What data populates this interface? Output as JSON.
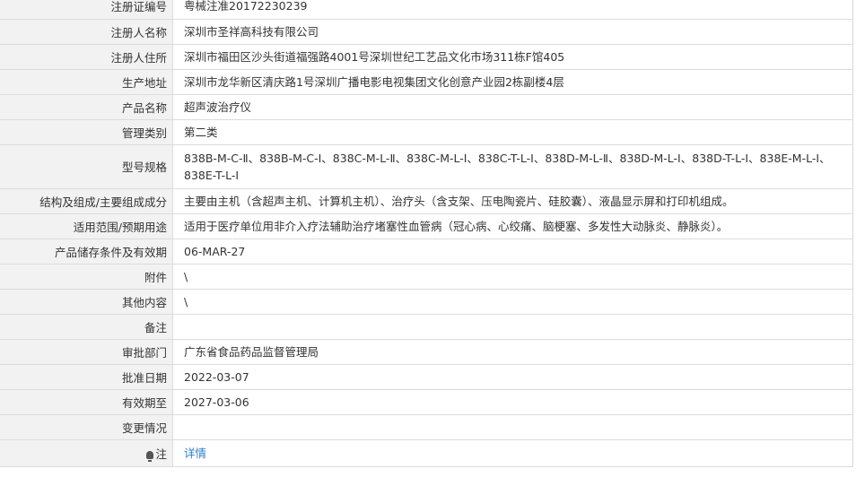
{
  "rows": [
    {
      "label": "注册证编号",
      "value": "粤械注准20172230239"
    },
    {
      "label": "注册人名称",
      "value": "深圳市圣祥高科技有限公司"
    },
    {
      "label": "注册人住所",
      "value": "深圳市福田区沙头街道福强路4001号深圳世纪工艺品文化市场311栋F馆405"
    },
    {
      "label": "生产地址",
      "value": "深圳市龙华新区清庆路1号深圳广播电影电视集团文化创意产业园2栋副楼4层"
    },
    {
      "label": "产品名称",
      "value": "超声波治疗仪"
    },
    {
      "label": "管理类别",
      "value": "第二类"
    },
    {
      "label": "型号规格",
      "value": "838B-M-C-Ⅱ、838B-M-C-Ⅰ、838C-M-L-Ⅱ、838C-M-L-Ⅰ、838C-T-L-Ⅰ、838D-M-L-Ⅱ、838D-M-L-Ⅰ、838D-T-L-Ⅰ、838E-M-L-Ⅰ、838E-T-L-Ⅰ"
    },
    {
      "label": "结构及组成/主要组成成分",
      "value": "主要由主机（含超声主机、计算机主机）、治疗头（含支架、压电陶瓷片、硅胶囊）、液晶显示屏和打印机组成。"
    },
    {
      "label": "适用范围/预期用途",
      "value": "适用于医疗单位用非介入疗法辅助治疗堵塞性血管病（冠心病、心绞痛、脑梗塞、多发性大动脉炎、静脉炎）。"
    },
    {
      "label": "产品储存条件及有效期",
      "value": "06-MAR-27"
    },
    {
      "label": "附件",
      "value": "\\"
    },
    {
      "label": "其他内容",
      "value": "\\"
    },
    {
      "label": "备注",
      "value": ""
    },
    {
      "label": "审批部门",
      "value": "广东省食品药品监督管理局"
    },
    {
      "label": "批准日期",
      "value": "2022-03-07"
    },
    {
      "label": "有效期至",
      "value": "2027-03-06"
    },
    {
      "label": "变更情况",
      "value": ""
    }
  ],
  "note": {
    "label": "注",
    "icon": "lightbulb-icon",
    "link_text": "详情"
  }
}
